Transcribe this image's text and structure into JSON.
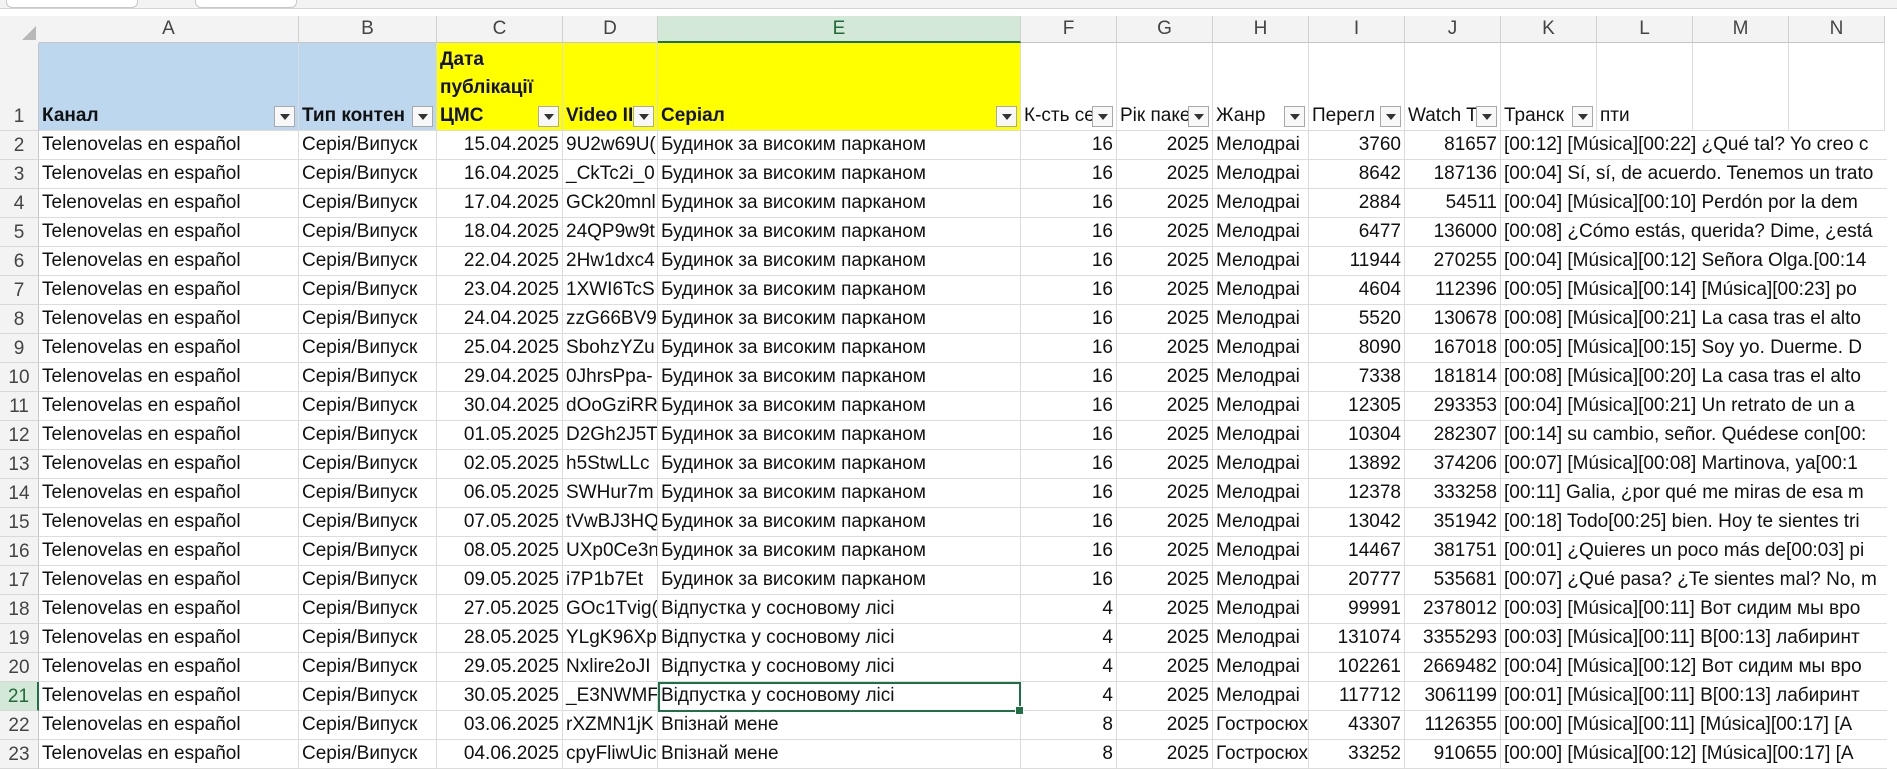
{
  "columns": [
    "A",
    "B",
    "C",
    "D",
    "E",
    "F",
    "G",
    "H",
    "I",
    "J",
    "K",
    "L",
    "M",
    "N"
  ],
  "selected_column": "E",
  "selected_row": "21",
  "selected_cell": "E21",
  "colors": {
    "header_blue": "#bdd7ee",
    "header_yellow": "#ffff00",
    "selection": "#1e7145"
  },
  "headers": {
    "A": "Канал",
    "B": "Тип контен",
    "C": "Дата публікації ЦМС",
    "C_lines": [
      "Дата",
      "публікації",
      "ЦМС"
    ],
    "D": "Video II",
    "E": "Серіал",
    "F": "К-сть се",
    "G": "Рік паке",
    "H": "Жанр",
    "I": "Перегл",
    "J": "Watch T",
    "K": "Транск",
    "L": "пти"
  },
  "row_numbers": [
    "1",
    "2",
    "3",
    "4",
    "5",
    "6",
    "7",
    "8",
    "9",
    "10",
    "11",
    "12",
    "13",
    "14",
    "15",
    "16",
    "17",
    "18",
    "19",
    "20",
    "21",
    "22",
    "23"
  ],
  "rows": [
    {
      "channel": "Telenovelas en español",
      "type": "Серія/Випуск",
      "date": "15.04.2025",
      "video": "9U2w69U(",
      "series": "Будинок за високим парканом",
      "eps": "16",
      "year": "2025",
      "genre": "Мелодраі",
      "views": "3760",
      "watch": "81657",
      "transcript": "[00:12] [Música][00:22] ¿Qué tal? Yo creo c"
    },
    {
      "channel": "Telenovelas en español",
      "type": "Серія/Випуск",
      "date": "16.04.2025",
      "video": "_CkTc2i_0",
      "series": "Будинок за високим парканом",
      "eps": "16",
      "year": "2025",
      "genre": "Мелодраі",
      "views": "8642",
      "watch": "187136",
      "transcript": "[00:04] Sí, sí, de acuerdo. Tenemos un trato"
    },
    {
      "channel": "Telenovelas en español",
      "type": "Серія/Випуск",
      "date": "17.04.2025",
      "video": "GCk20mnl",
      "series": "Будинок за високим парканом",
      "eps": "16",
      "year": "2025",
      "genre": "Мелодраі",
      "views": "2884",
      "watch": "54511",
      "transcript": "[00:04] [Música][00:10] Perdón por la dem"
    },
    {
      "channel": "Telenovelas en español",
      "type": "Серія/Випуск",
      "date": "18.04.2025",
      "video": "24QP9w9t",
      "series": "Будинок за високим парканом",
      "eps": "16",
      "year": "2025",
      "genre": "Мелодраі",
      "views": "6477",
      "watch": "136000",
      "transcript": "[00:08] ¿Cómo estás, querida? Dime, ¿está"
    },
    {
      "channel": "Telenovelas en español",
      "type": "Серія/Випуск",
      "date": "22.04.2025",
      "video": "2Hw1dxc4",
      "series": "Будинок за високим парканом",
      "eps": "16",
      "year": "2025",
      "genre": "Мелодраі",
      "views": "11944",
      "watch": "270255",
      "transcript": "[00:04] [Música][00:12] Señora Olga.[00:14"
    },
    {
      "channel": "Telenovelas en español",
      "type": "Серія/Випуск",
      "date": "23.04.2025",
      "video": "1XWI6TcS",
      "series": "Будинок за високим парканом",
      "eps": "16",
      "year": "2025",
      "genre": "Мелодраі",
      "views": "4604",
      "watch": "112396",
      "transcript": "[00:05] [Música][00:14] [Música][00:23] po"
    },
    {
      "channel": "Telenovelas en español",
      "type": "Серія/Випуск",
      "date": "24.04.2025",
      "video": "zzG66BV9",
      "series": "Будинок за високим парканом",
      "eps": "16",
      "year": "2025",
      "genre": "Мелодраі",
      "views": "5520",
      "watch": "130678",
      "transcript": "[00:08] [Música][00:21] La casa tras el alto"
    },
    {
      "channel": "Telenovelas en español",
      "type": "Серія/Випуск",
      "date": "25.04.2025",
      "video": "SbohzYZu",
      "series": "Будинок за високим парканом",
      "eps": "16",
      "year": "2025",
      "genre": "Мелодраі",
      "views": "8090",
      "watch": "167018",
      "transcript": "[00:05] [Música][00:15] Soy yo. Duerme. D"
    },
    {
      "channel": "Telenovelas en español",
      "type": "Серія/Випуск",
      "date": "29.04.2025",
      "video": "0JhrsPpa-",
      "series": "Будинок за високим парканом",
      "eps": "16",
      "year": "2025",
      "genre": "Мелодраі",
      "views": "7338",
      "watch": "181814",
      "transcript": "[00:08] [Música][00:20] La casa tras el alto"
    },
    {
      "channel": "Telenovelas en español",
      "type": "Серія/Випуск",
      "date": "30.04.2025",
      "video": "dOoGziRR",
      "series": "Будинок за високим парканом",
      "eps": "16",
      "year": "2025",
      "genre": "Мелодраі",
      "views": "12305",
      "watch": "293353",
      "transcript": "[00:04] [Música][00:21] Un retrato de un a"
    },
    {
      "channel": "Telenovelas en español",
      "type": "Серія/Випуск",
      "date": "01.05.2025",
      "video": "D2Gh2J5T",
      "series": "Будинок за високим парканом",
      "eps": "16",
      "year": "2025",
      "genre": "Мелодраі",
      "views": "10304",
      "watch": "282307",
      "transcript": "[00:14] su cambio, señor. Quédese con[00:"
    },
    {
      "channel": "Telenovelas en español",
      "type": "Серія/Випуск",
      "date": "02.05.2025",
      "video": "h5StwLLc",
      "series": "Будинок за високим парканом",
      "eps": "16",
      "year": "2025",
      "genre": "Мелодраі",
      "views": "13892",
      "watch": "374206",
      "transcript": "[00:07] [Música][00:08] Martinova, ya[00:1"
    },
    {
      "channel": "Telenovelas en español",
      "type": "Серія/Випуск",
      "date": "06.05.2025",
      "video": "SWHur7m",
      "series": "Будинок за високим парканом",
      "eps": "16",
      "year": "2025",
      "genre": "Мелодраі",
      "views": "12378",
      "watch": "333258",
      "transcript": "[00:11] Galia, ¿por qué me miras de esa m"
    },
    {
      "channel": "Telenovelas en español",
      "type": "Серія/Випуск",
      "date": "07.05.2025",
      "video": "tVwBJ3HQ",
      "series": "Будинок за високим парканом",
      "eps": "16",
      "year": "2025",
      "genre": "Мелодраі",
      "views": "13042",
      "watch": "351942",
      "transcript": "[00:18] Todo[00:25] bien. Hoy te sientes tri"
    },
    {
      "channel": "Telenovelas en español",
      "type": "Серія/Випуск",
      "date": "08.05.2025",
      "video": "UXp0Ce3n",
      "series": "Будинок за високим парканом",
      "eps": "16",
      "year": "2025",
      "genre": "Мелодраі",
      "views": "14467",
      "watch": "381751",
      "transcript": "[00:01] ¿Quieres un poco más de[00:03] pi"
    },
    {
      "channel": "Telenovelas en español",
      "type": "Серія/Випуск",
      "date": "09.05.2025",
      "video": "i7P1b7Et",
      "series": "Будинок за високим парканом",
      "eps": "16",
      "year": "2025",
      "genre": "Мелодраі",
      "views": "20777",
      "watch": "535681",
      "transcript": "[00:07] ¿Qué pasa? ¿Te sientes mal? No, m"
    },
    {
      "channel": "Telenovelas en español",
      "type": "Серія/Випуск",
      "date": "27.05.2025",
      "video": "GOc1Tvig(",
      "series": "Відпустка у сосновому лісі",
      "eps": "4",
      "year": "2025",
      "genre": "Мелодраі",
      "views": "99991",
      "watch": "2378012",
      "transcript": "[00:03] [Música][00:11] Вот сидим мы вро"
    },
    {
      "channel": "Telenovelas en español",
      "type": "Серія/Випуск",
      "date": "28.05.2025",
      "video": "YLgK96Xpt",
      "series": "Відпустка у сосновому лісі",
      "eps": "4",
      "year": "2025",
      "genre": "Мелодраі",
      "views": "131074",
      "watch": "3355293",
      "transcript": "[00:03] [Música][00:11] В[00:13] лабиринт"
    },
    {
      "channel": "Telenovelas en español",
      "type": "Серія/Випуск",
      "date": "29.05.2025",
      "video": "Nxlire2oJI",
      "series": "Відпустка у сосновому лісі",
      "eps": "4",
      "year": "2025",
      "genre": "Мелодраі",
      "views": "102261",
      "watch": "2669482",
      "transcript": "[00:04] [Música][00:12] Вот сидим мы вро"
    },
    {
      "channel": "Telenovelas en español",
      "type": "Серія/Випуск",
      "date": "30.05.2025",
      "video": "_E3NWMF",
      "series": "Відпустка у сосновому лісі",
      "eps": "4",
      "year": "2025",
      "genre": "Мелодраі",
      "views": "117712",
      "watch": "3061199",
      "transcript": "[00:01] [Música][00:11] В[00:13] лабиринт"
    },
    {
      "channel": "Telenovelas en español",
      "type": "Серія/Випуск",
      "date": "03.06.2025",
      "video": "rXZMN1jK",
      "series": "Впізнай мене",
      "eps": "8",
      "year": "2025",
      "genre": "Гостросюх",
      "views": "43307",
      "watch": "1126355",
      "transcript": "[00:00] [Música][00:11] [Música][00:17] [A"
    },
    {
      "channel": "Telenovelas en español",
      "type": "Серія/Випуск",
      "date": "04.06.2025",
      "video": "cpyFliwUic",
      "series": "Впізнай мене",
      "eps": "8",
      "year": "2025",
      "genre": "Гостросюх",
      "views": "33252",
      "watch": "910655",
      "transcript": "[00:00] [Música][00:12] [Música][00:17] [A"
    }
  ]
}
